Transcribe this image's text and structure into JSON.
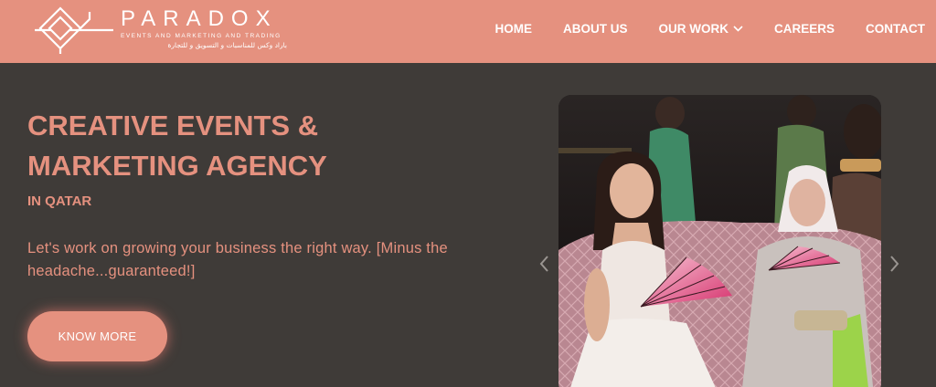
{
  "header": {
    "brand": "PARADOX",
    "tagline": "EVENTS AND MARKETING AND TRADING",
    "tagline_ar": "باراد وكس للمناسبات و التسويق و للتجارة",
    "color": "#e5917f"
  },
  "nav": {
    "items": [
      {
        "label": "HOME"
      },
      {
        "label": "ABOUT US"
      },
      {
        "label": "OUR WORK",
        "icon": "chevron-down-icon"
      },
      {
        "label": "CAREERS"
      },
      {
        "label": "CONTACT"
      }
    ]
  },
  "hero": {
    "title": "CREATIVE EVENTS & MARKETING AGENCY",
    "subtitle": "IN QATAR",
    "description": "Let's work on growing your business the right way. [Minus the headache...guaranteed!]",
    "cta_label": "KNOW MORE",
    "background": "#3f3b38"
  },
  "carousel": {
    "prev_icon": "chevron-left-icon",
    "next_icon": "chevron-right-icon"
  }
}
